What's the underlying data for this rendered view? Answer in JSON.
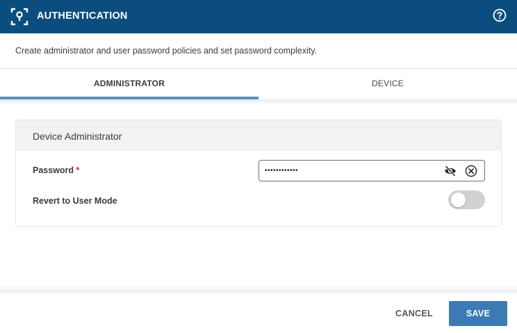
{
  "header": {
    "title": "AUTHENTICATION",
    "icon": "focus-user-icon",
    "help_icon": "help-circle-icon",
    "background": "#0b4d7e"
  },
  "description": "Create administrator and user password policies and set password complexity.",
  "tabs": [
    {
      "label": "ADMINISTRATOR",
      "active": true
    },
    {
      "label": "DEVICE",
      "active": false
    }
  ],
  "card": {
    "title": "Device Administrator",
    "password": {
      "label": "Password",
      "required_marker": "*",
      "value": "••••••••••••",
      "icons": [
        "eye-off-icon",
        "clear-circle-icon"
      ]
    },
    "revert": {
      "label": "Revert to User Mode",
      "enabled": false
    }
  },
  "footer": {
    "cancel_label": "CANCEL",
    "save_label": "SAVE",
    "accent": "#3d7ab4"
  }
}
